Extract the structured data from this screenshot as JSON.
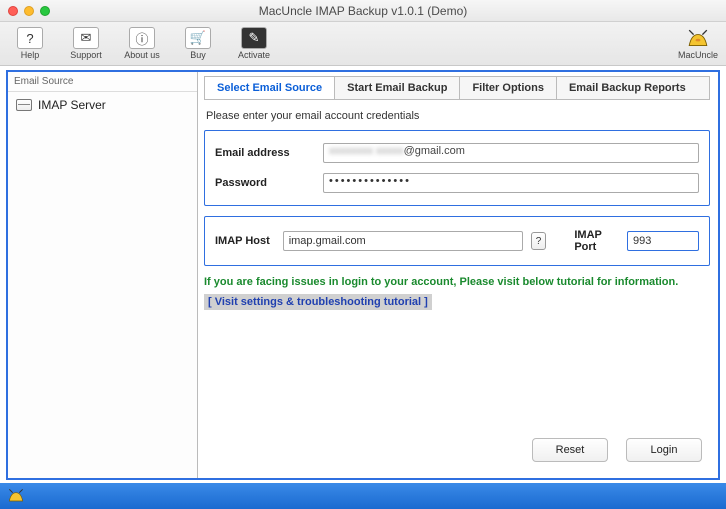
{
  "window": {
    "title": "MacUncle IMAP Backup v1.0.1 (Demo)"
  },
  "toolbar": {
    "items": [
      {
        "label": "Help",
        "glyph": "?"
      },
      {
        "label": "Support",
        "glyph": "✉"
      },
      {
        "label": "About us",
        "glyph": "ⓘ"
      },
      {
        "label": "Buy",
        "glyph": "🛒"
      },
      {
        "label": "Activate",
        "glyph": "✎"
      }
    ],
    "brand": "MacUncle"
  },
  "sidebar": {
    "header": "Email Source",
    "items": [
      {
        "label": "IMAP Server"
      }
    ]
  },
  "tabs": {
    "items": [
      {
        "label": "Select Email Source",
        "active": true
      },
      {
        "label": "Start Email Backup",
        "active": false
      },
      {
        "label": "Filter Options",
        "active": false
      },
      {
        "label": "Email Backup Reports",
        "active": false
      }
    ]
  },
  "form": {
    "instruction": "Please enter your email account credentials",
    "email_label": "Email address",
    "email_blurred_prefix": "xxxxxxxx xxxxx",
    "email_visible_suffix": "@gmail.com",
    "password_label": "Password",
    "password_value": "••••••••••••••",
    "imap_host_label": "IMAP Host",
    "imap_host_value": "imap.gmail.com",
    "imap_port_label": "IMAP Port",
    "imap_port_value": "993",
    "help_glyph": "?",
    "note": "If you are facing issues in login to your account, Please visit below tutorial for information.",
    "link": "[ Visit settings & troubleshooting tutorial ]",
    "reset": "Reset",
    "login": "Login"
  }
}
